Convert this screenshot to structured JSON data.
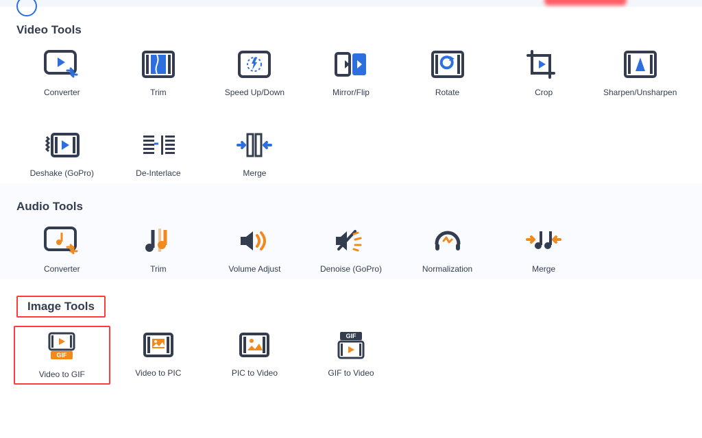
{
  "sections": {
    "video": {
      "title": "Video Tools",
      "items": [
        {
          "label": "Converter",
          "icon": "video-converter-icon"
        },
        {
          "label": "Trim",
          "icon": "video-trim-icon"
        },
        {
          "label": "Speed Up/Down",
          "icon": "video-speed-icon"
        },
        {
          "label": "Mirror/Flip",
          "icon": "video-mirror-icon"
        },
        {
          "label": "Rotate",
          "icon": "video-rotate-icon"
        },
        {
          "label": "Crop",
          "icon": "video-crop-icon"
        },
        {
          "label": "Sharpen/Unsharpen",
          "icon": "video-sharpen-icon"
        },
        {
          "label": "Deshake (GoPro)",
          "icon": "video-deshake-icon"
        },
        {
          "label": "De-Interlace",
          "icon": "video-deinterlace-icon"
        },
        {
          "label": "Merge",
          "icon": "video-merge-icon"
        }
      ]
    },
    "audio": {
      "title": "Audio Tools",
      "items": [
        {
          "label": "Converter",
          "icon": "audio-converter-icon"
        },
        {
          "label": "Trim",
          "icon": "audio-trim-icon"
        },
        {
          "label": "Volume Adjust",
          "icon": "audio-volume-icon"
        },
        {
          "label": "Denoise (GoPro)",
          "icon": "audio-denoise-icon"
        },
        {
          "label": "Normalization",
          "icon": "audio-normalize-icon"
        },
        {
          "label": "Merge",
          "icon": "audio-merge-icon"
        }
      ]
    },
    "image": {
      "title": "Image Tools",
      "items": [
        {
          "label": "Video to GIF",
          "icon": "image-video-to-gif-icon",
          "highlight": true
        },
        {
          "label": "Video to PIC",
          "icon": "image-video-to-pic-icon"
        },
        {
          "label": "PIC to Video",
          "icon": "image-pic-to-video-icon"
        },
        {
          "label": "GIF to Video",
          "icon": "image-gif-to-video-icon"
        }
      ]
    }
  },
  "colors": {
    "navy": "#333d4f",
    "blue": "#2e6fe0",
    "orange": "#f08a1d"
  }
}
